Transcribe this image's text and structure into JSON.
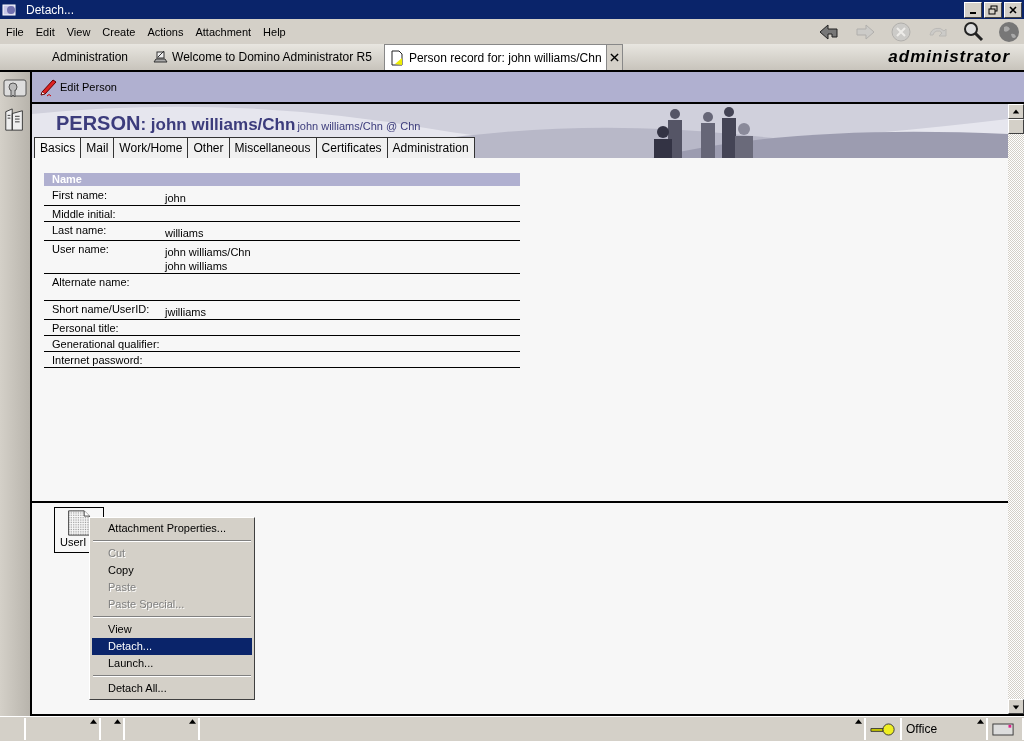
{
  "window": {
    "title": "Detach..."
  },
  "menu": [
    "File",
    "Edit",
    "View",
    "Create",
    "Actions",
    "Attachment",
    "Help"
  ],
  "toolbar": [
    {
      "kind": "back",
      "disabled": false
    },
    {
      "kind": "forward",
      "disabled": true
    },
    {
      "kind": "stop",
      "disabled": true
    },
    {
      "kind": "refresh",
      "disabled": true
    },
    {
      "kind": "search",
      "disabled": false
    },
    {
      "kind": "globe",
      "disabled": false
    }
  ],
  "window_tabs": [
    {
      "label": "Administration",
      "kind": "plain",
      "selected": false,
      "closable": false
    },
    {
      "label": "Welcome to Domino Administrator R5",
      "kind": "desk",
      "selected": false,
      "closable": false
    },
    {
      "label": "Person record for: john williams/Chn",
      "kind": "page",
      "selected": true,
      "closable": true
    }
  ],
  "brand": "administrator",
  "action_bar": [
    {
      "label": "Edit Person"
    }
  ],
  "header": {
    "kind_label": "PERSON",
    "name": ": john williams/Chn",
    "subtitle": "john williams/Chn @ Chn"
  },
  "form_tabs": [
    {
      "label": "Basics",
      "selected": true
    },
    {
      "label": "Mail",
      "selected": false
    },
    {
      "label": "Work/Home",
      "selected": false
    },
    {
      "label": "Other",
      "selected": false
    },
    {
      "label": "Miscellaneous",
      "selected": false
    },
    {
      "label": "Certificates",
      "selected": false
    },
    {
      "label": "Administration",
      "selected": false
    }
  ],
  "section": {
    "title": "Name",
    "fields": [
      {
        "label": "First name:",
        "values": [
          "john"
        ],
        "tall": false
      },
      {
        "label": "Middle initial:",
        "tall": false
      },
      {
        "label": "Last name:",
        "values": [
          "williams"
        ],
        "tall": false
      },
      {
        "label": "User name:",
        "values": [
          "john williams/Chn",
          "john williams"
        ],
        "tall": false
      },
      {
        "label": "Alternate name:",
        "tall": true
      },
      {
        "label": "Short name/UserID:",
        "values": [
          "jwilliams"
        ],
        "tall": false
      },
      {
        "label": "Personal title:",
        "tall": false
      },
      {
        "label": "Generational qualifier:",
        "tall": false
      },
      {
        "label": "Internet password:",
        "tall": false
      }
    ]
  },
  "attachment": {
    "name": "UserI"
  },
  "context_menu": [
    {
      "kind": "item",
      "label": "Attachment Properties...",
      "disabled": false,
      "selected": false
    },
    {
      "kind": "separator"
    },
    {
      "kind": "item",
      "label": "Cut",
      "disabled": true,
      "selected": false
    },
    {
      "kind": "item",
      "label": "Copy",
      "disabled": false,
      "selected": false
    },
    {
      "kind": "item",
      "label": "Paste",
      "disabled": true,
      "selected": false
    },
    {
      "kind": "item",
      "label": "Paste Special...",
      "disabled": true,
      "selected": false
    },
    {
      "kind": "separator"
    },
    {
      "kind": "item",
      "label": "View",
      "disabled": false,
      "selected": false
    },
    {
      "kind": "item",
      "label": "Detach...",
      "disabled": false,
      "selected": true
    },
    {
      "kind": "item",
      "label": "Launch...",
      "disabled": false,
      "selected": false
    },
    {
      "kind": "separator"
    },
    {
      "kind": "item",
      "label": "Detach All...",
      "disabled": false,
      "selected": false
    }
  ],
  "status_bar": {
    "location": "Office"
  }
}
